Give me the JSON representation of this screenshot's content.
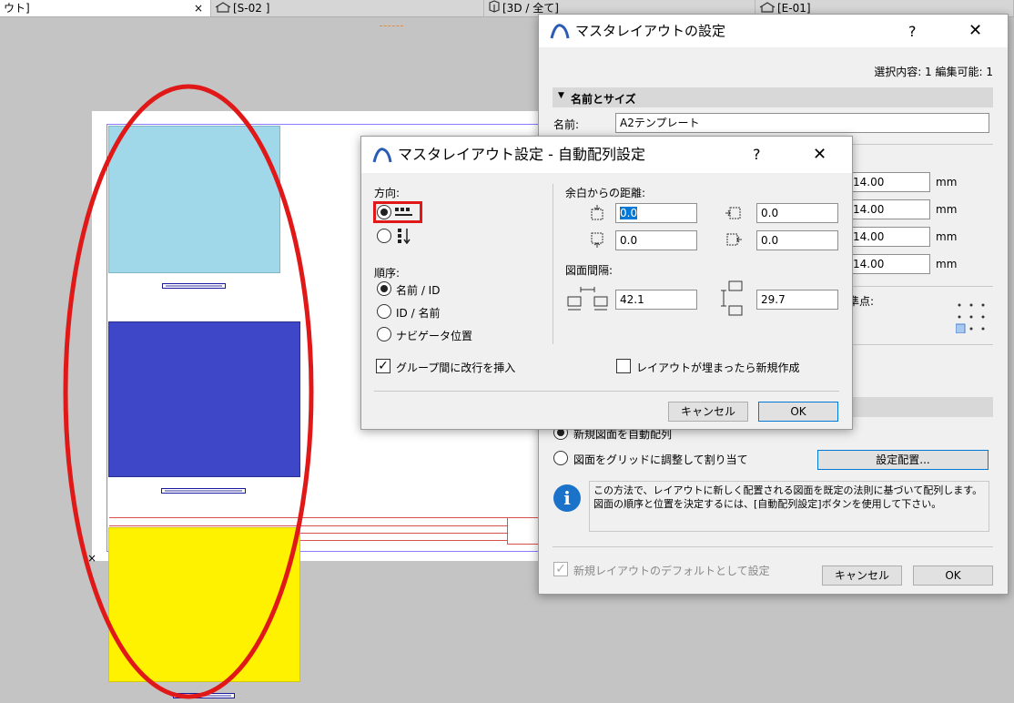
{
  "tabs": [
    {
      "label": "ウト]",
      "close": "×"
    },
    {
      "label": "[S-02 ]"
    },
    {
      "label": "[3D / 全て]"
    },
    {
      "label": "[E-01]"
    }
  ],
  "master_dialog": {
    "title": "マスタレイアウトの設定",
    "help": "?",
    "close": "✕",
    "selection_info": "選択内容: 1 編集可能: 1",
    "section_name_size": "名前とサイズ",
    "name_label": "名前:",
    "name_value": "A2テンプレート",
    "margins": [
      "14.00",
      "14.00",
      "14.00",
      "14.00"
    ],
    "unit": "mm",
    "anchor_label_partial": "準点:",
    "radio_auto_partial": "新規図面を自動配列",
    "radio_grid": "図面をグリッドに調整して割り当て",
    "settings_button": "設定配置...",
    "info_text": "この方法で、レイアウトに新しく配置される図面を既定の法則に基づいて配列します。図面の順序と位置を決定するには、[自動配列設定]ボタンを使用して下さい。",
    "default_checkbox": "新規レイアウトのデフォルトとして設定",
    "cancel": "キャンセル",
    "ok": "OK"
  },
  "auto_dialog": {
    "title": "マスタレイアウト設定 - 自動配列設定",
    "help": "?",
    "close": "✕",
    "direction_label": "方向:",
    "order_label": "順序:",
    "order_options": [
      "名前 / ID",
      "ID / 名前",
      "ナビゲータ位置"
    ],
    "margin_label": "余白からの距離:",
    "margin_top": "0.0",
    "margin_left": "0.0",
    "margin_bottom": "0.0",
    "margin_right": "0.0",
    "spacing_label": "図面間隔:",
    "spacing_h": "42.1",
    "spacing_v": "29.7",
    "group_break": "グループ間に改行を挿入",
    "new_when_full": "レイアウトが埋まったら新規作成",
    "cancel": "キャンセル",
    "ok": "OK"
  },
  "colors": {
    "drawing1": "#a0d8ea",
    "drawing2": "#3e47c8",
    "drawing3": "#fff200",
    "annotation_red": "#e01818"
  }
}
